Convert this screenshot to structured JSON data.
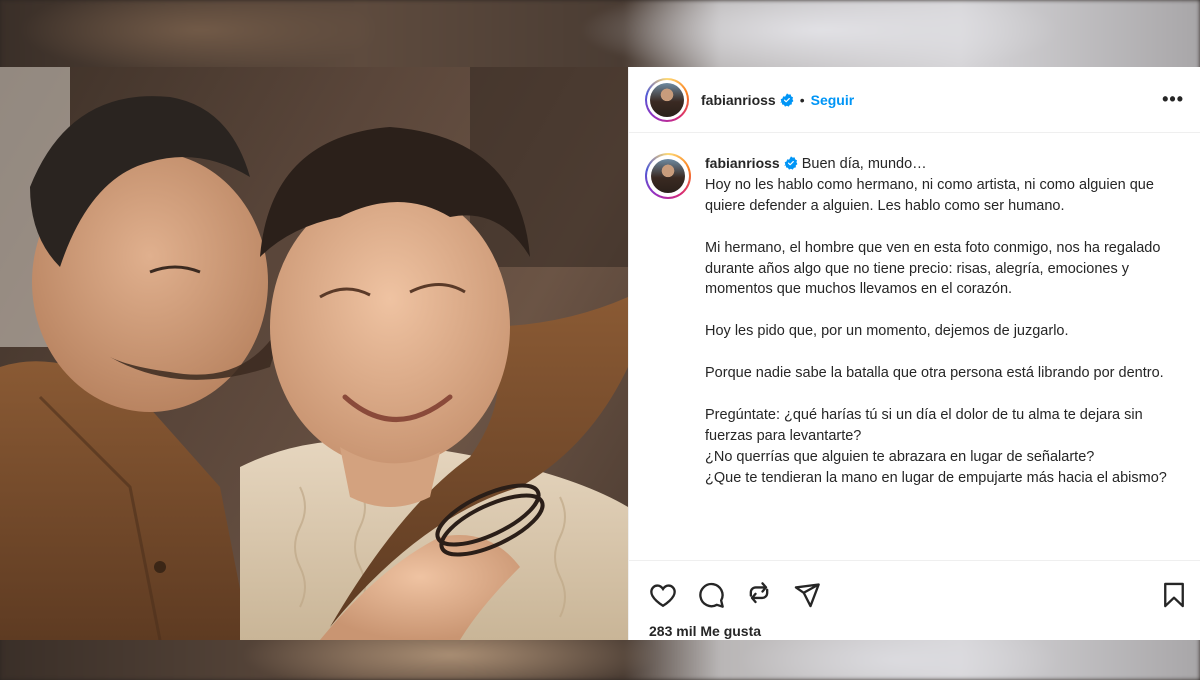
{
  "post": {
    "username": "fabianrioss",
    "follow_label": "Seguir",
    "more_label": "•••",
    "caption": {
      "username": "fabianrioss",
      "opening": "Buen día, mundo…",
      "paragraphs": [
        "Hoy no les hablo como hermano, ni como artista, ni como alguien que quiere defender a alguien. Les hablo como ser humano.",
        "Mi hermano, el hombre que ven en esta foto conmigo, nos ha regalado durante años algo que no tiene precio: risas, alegría, emociones y momentos que muchos llevamos en el corazón.",
        "Hoy les pido que, por un momento, dejemos de juzgarlo.",
        "Porque nadie sabe la batalla que otra persona está librando por dentro.",
        "Pregúntate: ¿qué harías tú si un día el dolor de tu alma te dejara sin fuerzas para levantarte?",
        "¿No querrías que alguien te abrazara en lugar de señalarte?",
        "¿Que te tendieran la mano en lugar de empujarte más hacia el abismo?"
      ]
    },
    "likes_text": "283 mil Me gusta"
  },
  "icons": {
    "like": "heart-icon",
    "comment": "comment-icon",
    "repost": "repost-icon",
    "share": "share-icon",
    "save": "bookmark-icon",
    "verified": "verified-badge-icon"
  },
  "colors": {
    "accent": "#0095f6",
    "text": "#262626",
    "verified": "#0095f6"
  }
}
